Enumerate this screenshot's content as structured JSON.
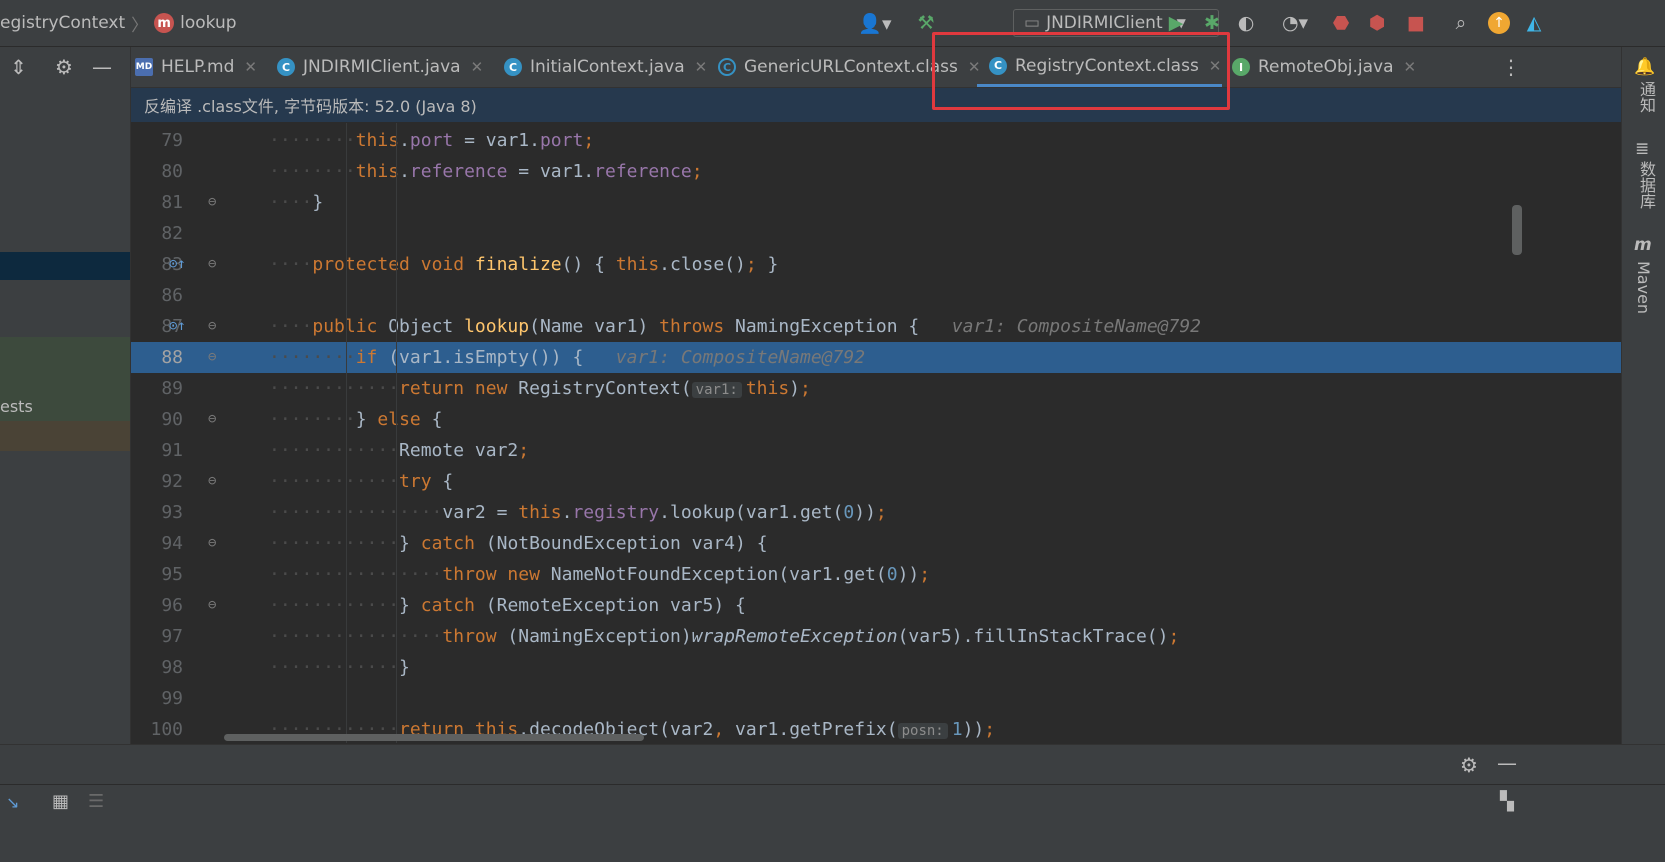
{
  "breadcrumb": {
    "class": "egistryContext",
    "method_badge": "m",
    "method": "lookup"
  },
  "toolbar": {
    "run_config": "JNDIRMIClient",
    "dropdown": "▼"
  },
  "tabs": [
    {
      "label": "HELP.md",
      "icon": "MD"
    },
    {
      "label": "JNDIRMIClient.java",
      "icon": "C"
    },
    {
      "label": "InitialContext.java",
      "icon": "C"
    },
    {
      "label": "GenericURLContext.class",
      "icon": "C"
    },
    {
      "label": "RegistryContext.class",
      "icon": "C"
    },
    {
      "label": "RemoteObj.java",
      "icon": "I"
    }
  ],
  "banner": "反编译 .class文件, 字节码版本: 52.0 (Java 8)",
  "left_panel": {
    "partial_item": "ests"
  },
  "right_strip": {
    "notifications": "通知",
    "database": "数据库",
    "maven": "Maven"
  },
  "code": {
    "lines": [
      {
        "n": "79",
        "indent": "········",
        "parts": [
          [
            "fld-this",
            "this"
          ],
          [
            "p",
            "."
          ],
          [
            "fld",
            "port"
          ],
          [
            "p",
            " = var1."
          ],
          [
            "fld",
            "port"
          ],
          [
            "kw",
            ";"
          ]
        ]
      },
      {
        "n": "80",
        "indent": "········",
        "parts": [
          [
            "fld-this",
            "this"
          ],
          [
            "p",
            "."
          ],
          [
            "fld",
            "reference"
          ],
          [
            "p",
            " = var1."
          ],
          [
            "fld",
            "reference"
          ],
          [
            "kw",
            ";"
          ]
        ]
      },
      {
        "n": "81",
        "indent": "····",
        "parts": [
          [
            "p",
            "}"
          ]
        ]
      },
      {
        "n": "82",
        "indent": "",
        "parts": []
      },
      {
        "n": "83",
        "indent": "····",
        "parts": [
          [
            "kw",
            "protected void "
          ],
          [
            "fn",
            "finalize"
          ],
          [
            "p",
            "() { "
          ],
          [
            "kw",
            "this"
          ],
          [
            "p",
            ".close()"
          ],
          [
            "kw",
            ";"
          ],
          [
            "p",
            " }"
          ]
        ]
      },
      {
        "n": "86",
        "indent": "",
        "parts": []
      },
      {
        "n": "87",
        "indent": "····",
        "parts": [
          [
            "kw",
            "public "
          ],
          [
            "p",
            "Object "
          ],
          [
            "fn",
            "lookup"
          ],
          [
            "p",
            "(Name var1) "
          ],
          [
            "kw",
            "throws "
          ],
          [
            "p",
            "NamingException {   "
          ],
          [
            "inlay",
            "var1: CompositeName@792"
          ]
        ]
      },
      {
        "n": "88",
        "indent": "········",
        "parts": [
          [
            "kw",
            "if "
          ],
          [
            "p",
            "(var1.isEmpty()) {   "
          ],
          [
            "inlay",
            "var1: CompositeName@792"
          ]
        ]
      },
      {
        "n": "89",
        "indent": "············",
        "parts": [
          [
            "kw",
            "return new "
          ],
          [
            "p",
            "RegistryContext("
          ],
          [
            "hint",
            "var1:"
          ],
          [
            "kw",
            "this"
          ],
          [
            "p",
            ")"
          ],
          [
            "kw",
            ";"
          ]
        ]
      },
      {
        "n": "90",
        "indent": "········",
        "parts": [
          [
            "p",
            "} "
          ],
          [
            "kw",
            "else "
          ],
          [
            "p",
            "{"
          ]
        ]
      },
      {
        "n": "91",
        "indent": "············",
        "parts": [
          [
            "p",
            "Remote var2"
          ],
          [
            "kw",
            ";"
          ]
        ]
      },
      {
        "n": "92",
        "indent": "············",
        "parts": [
          [
            "kw",
            "try "
          ],
          [
            "p",
            "{"
          ]
        ]
      },
      {
        "n": "93",
        "indent": "················",
        "parts": [
          [
            "p",
            "var2 = "
          ],
          [
            "kw",
            "this"
          ],
          [
            "p",
            "."
          ],
          [
            "fld",
            "registry"
          ],
          [
            "p",
            ".lookup(var1.get("
          ],
          [
            "num",
            "0"
          ],
          [
            "p",
            "))"
          ],
          [
            "kw",
            ";"
          ]
        ]
      },
      {
        "n": "94",
        "indent": "············",
        "parts": [
          [
            "p",
            "} "
          ],
          [
            "kw",
            "catch "
          ],
          [
            "p",
            "(NotBoundException var4) {"
          ]
        ]
      },
      {
        "n": "95",
        "indent": "················",
        "parts": [
          [
            "kw",
            "throw new "
          ],
          [
            "p",
            "NameNotFoundException(var1.get("
          ],
          [
            "num",
            "0"
          ],
          [
            "p",
            "))"
          ],
          [
            "kw",
            ";"
          ]
        ]
      },
      {
        "n": "96",
        "indent": "············",
        "parts": [
          [
            "p",
            "} "
          ],
          [
            "kw",
            "catch "
          ],
          [
            "p",
            "(RemoteException var5) {"
          ]
        ]
      },
      {
        "n": "97",
        "indent": "················",
        "parts": [
          [
            "kw",
            "throw "
          ],
          [
            "p",
            "(NamingException)"
          ],
          [
            "it",
            "wrapRemoteException"
          ],
          [
            "p",
            "(var5).fillInStackTrace()"
          ],
          [
            "kw",
            ";"
          ]
        ]
      },
      {
        "n": "98",
        "indent": "············",
        "parts": [
          [
            "p",
            "}"
          ]
        ]
      },
      {
        "n": "99",
        "indent": "",
        "parts": []
      },
      {
        "n": "100",
        "indent": "············",
        "parts": [
          [
            "kw",
            "return "
          ],
          [
            "kw",
            "this"
          ],
          [
            "p",
            ".decodeObject(var2"
          ],
          [
            "kw",
            ", "
          ],
          [
            "p",
            "var1.getPrefix("
          ],
          [
            "hint",
            "posn:"
          ],
          [
            "num",
            "1"
          ],
          [
            "p",
            "))"
          ],
          [
            "kw",
            ";"
          ]
        ]
      }
    ],
    "highlight_line": "88"
  }
}
